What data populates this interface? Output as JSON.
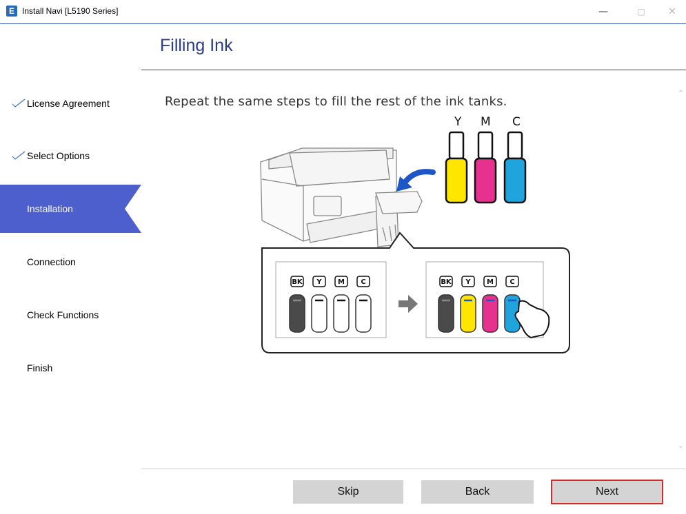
{
  "window": {
    "app_icon_glyph": "E",
    "title": "Install Navi [L5190 Series]",
    "minimize_glyph": "—",
    "maximize_glyph": "□",
    "close_glyph": "✕"
  },
  "sidebar": {
    "steps": [
      {
        "label": "License Agreement",
        "completed": true
      },
      {
        "label": "Select Options",
        "completed": true
      },
      {
        "label": "Installation",
        "active": true
      },
      {
        "label": "Connection"
      },
      {
        "label": "Check Functions"
      },
      {
        "label": "Finish"
      }
    ]
  },
  "header": {
    "title": "Filling Ink"
  },
  "content": {
    "instruction": "Repeat the same steps to fill the rest of the ink tanks.",
    "bottles": [
      {
        "label": "Y",
        "color": "#ffe600"
      },
      {
        "label": "M",
        "color": "#e6318f"
      },
      {
        "label": "C",
        "color": "#1fa4dd"
      }
    ],
    "tanks": [
      "BK",
      "Y",
      "M",
      "C"
    ],
    "colors": {
      "black_ink": "#4a4a4a",
      "accent_blue": "#1e56c8"
    }
  },
  "footer": {
    "skip_label": "Skip",
    "back_label": "Back",
    "next_label": "Next"
  },
  "theme": {
    "title_color": "#2a3c8e",
    "active_step_bg": "#4c5fcd",
    "next_highlight": "#d42a2a"
  }
}
